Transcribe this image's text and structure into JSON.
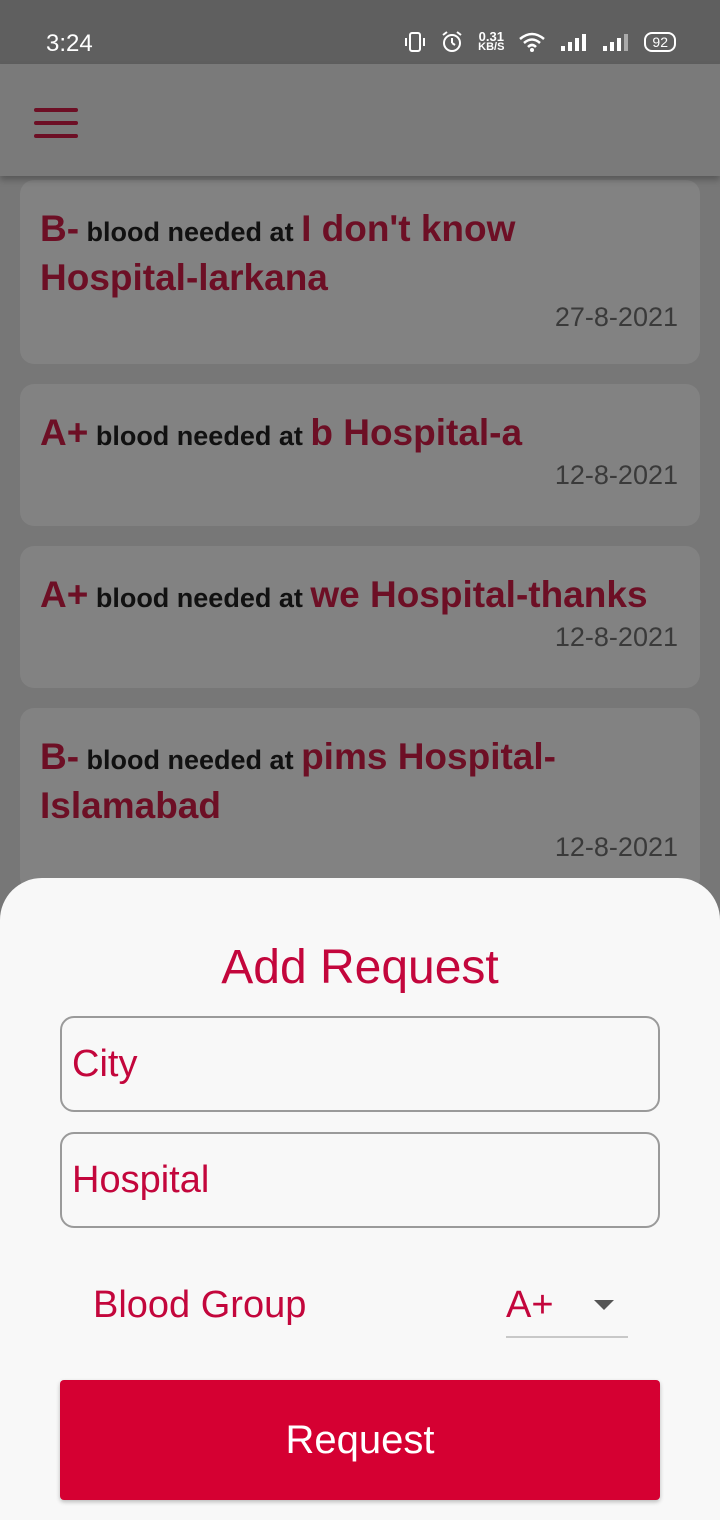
{
  "status_bar": {
    "time": "3:24",
    "net_speed_value": "0.31",
    "net_speed_unit": "KB/S",
    "battery": "92",
    "icons": [
      "vibrate-icon",
      "alarm-icon",
      "wifi-icon",
      "signal-icon",
      "signal-icon-2",
      "battery-icon"
    ]
  },
  "app_bar": {
    "menu_icon": "hamburger-menu-icon"
  },
  "requests": [
    {
      "group": "B-",
      "connector": " blood needed at ",
      "location": "I don't know Hospital-larkana",
      "date": "27-8-2021"
    },
    {
      "group": "A+",
      "connector": " blood needed at ",
      "location": "b Hospital-a",
      "date": "12-8-2021"
    },
    {
      "group": "A+",
      "connector": " blood needed at ",
      "location": "we Hospital-thanks",
      "date": "12-8-2021"
    },
    {
      "group": "B-",
      "connector": " blood needed at ",
      "location": "pims Hospital-Islamabad",
      "date": "12-8-2021"
    }
  ],
  "sheet": {
    "title": "Add Request",
    "city_placeholder": "City",
    "hospital_placeholder": "Hospital",
    "blood_group_label": "Blood Group",
    "blood_group_value": "A+",
    "button_label": "Request"
  },
  "colors": {
    "accent": "#c3063c",
    "button": "#d50032",
    "card_text": "#6d0f25"
  }
}
